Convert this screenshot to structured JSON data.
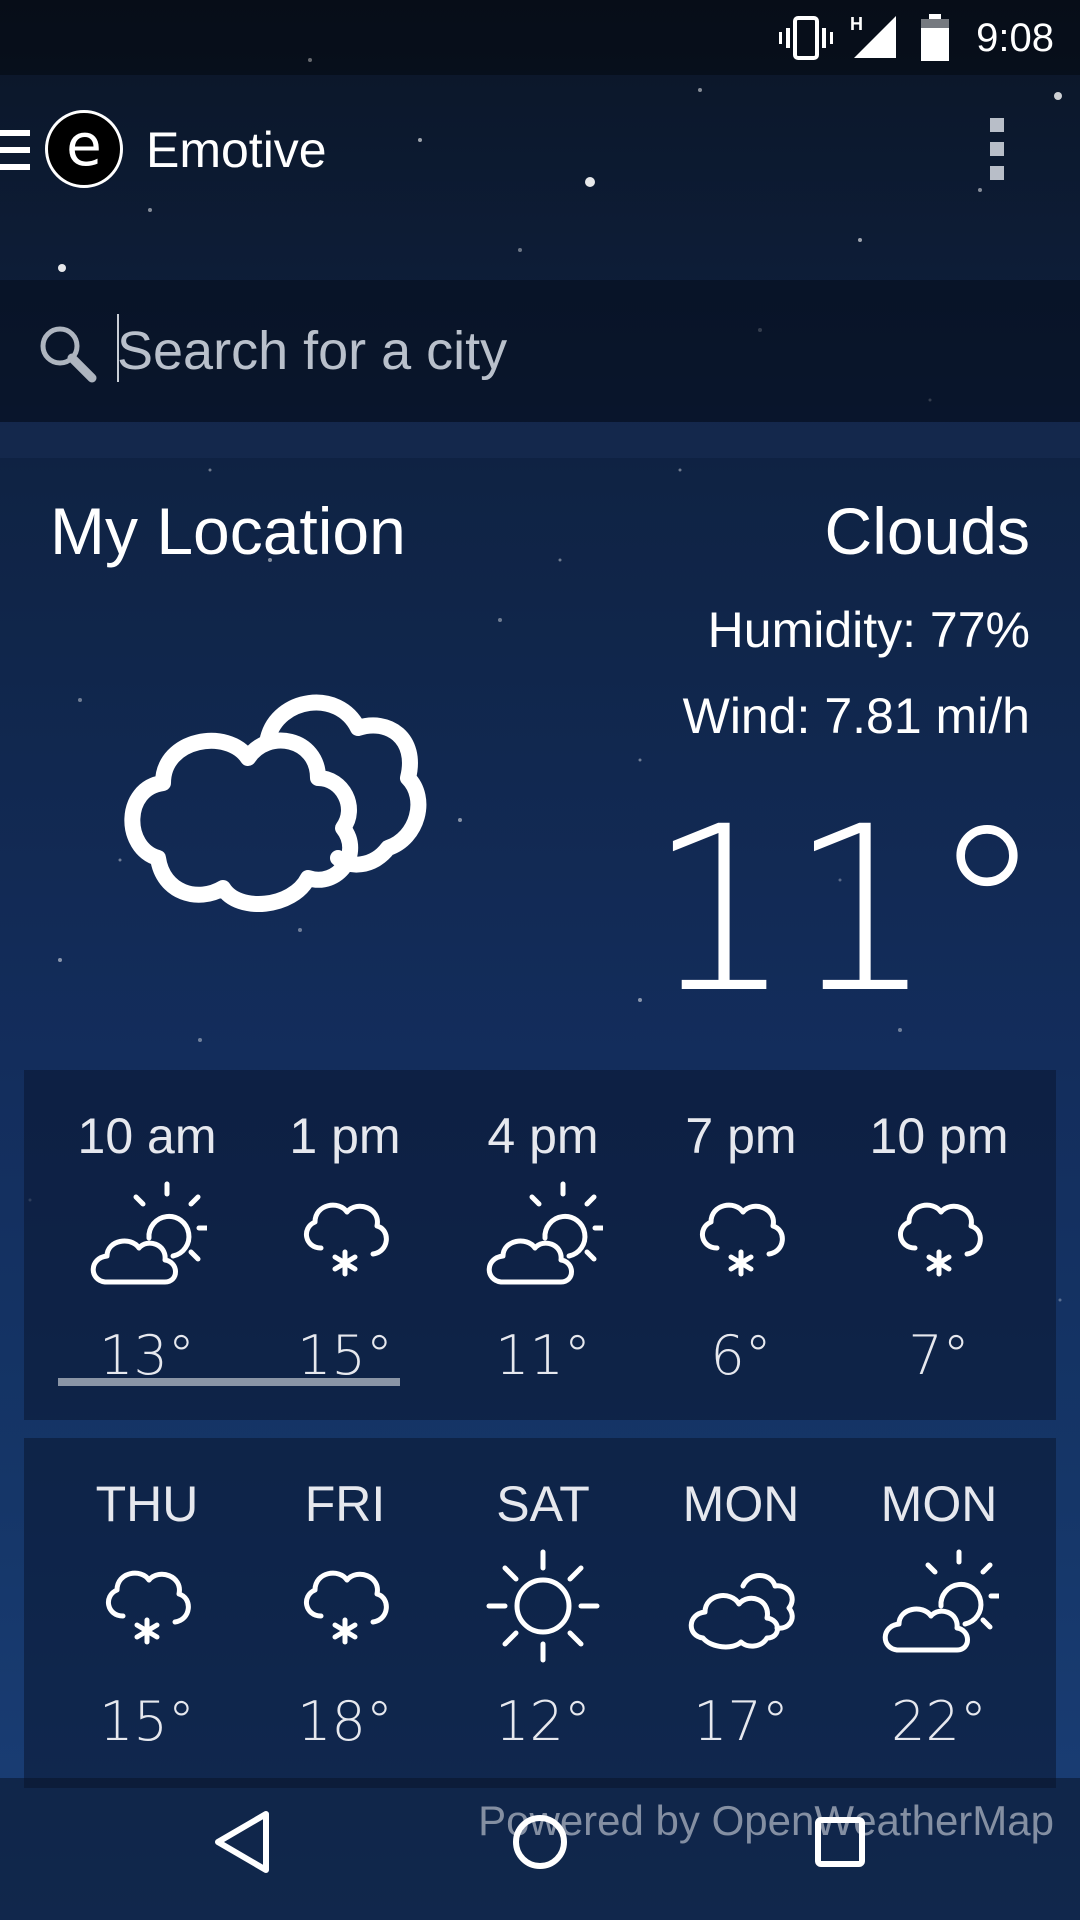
{
  "status_bar": {
    "time": "9:08",
    "network": "H"
  },
  "app": {
    "logo_letter": "e",
    "title": "Emotive"
  },
  "search": {
    "placeholder": "Search for a city",
    "value": ""
  },
  "current": {
    "location": "My Location",
    "condition": "Clouds",
    "humidity": "Humidity: 77%",
    "wind": "Wind: 7.81 mi/h",
    "temperature": "11°",
    "icon": "clouds-icon"
  },
  "hourly": [
    {
      "label": "10 am",
      "icon": "partly-cloudy-icon",
      "temp": "13°"
    },
    {
      "label": "1 pm",
      "icon": "snow-cloud-icon",
      "temp": "15°"
    },
    {
      "label": "4 pm",
      "icon": "partly-cloudy-icon",
      "temp": "11°"
    },
    {
      "label": "7 pm",
      "icon": "snow-cloud-icon",
      "temp": "6°"
    },
    {
      "label": "10 pm",
      "icon": "snow-cloud-icon",
      "temp": "7°"
    }
  ],
  "daily": [
    {
      "label": "THU",
      "icon": "snow-cloud-icon",
      "temp": "15°"
    },
    {
      "label": "FRI",
      "icon": "snow-cloud-icon",
      "temp": "18°"
    },
    {
      "label": "SAT",
      "icon": "sun-icon",
      "temp": "12°"
    },
    {
      "label": "MON",
      "icon": "clouds-icon",
      "temp": "17°"
    },
    {
      "label": "MON",
      "icon": "partly-cloudy-icon",
      "temp": "22°"
    }
  ],
  "footer": {
    "powered_by": "Powered by OpenWeatherMap"
  },
  "colors": {
    "background_top": "#0b1526",
    "background_bottom": "#1b3f78",
    "text": "#ffffff"
  }
}
